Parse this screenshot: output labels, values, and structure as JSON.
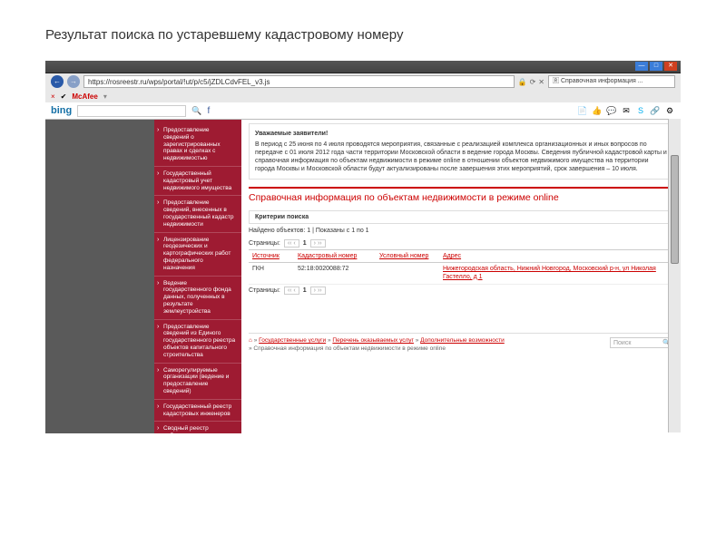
{
  "caption": "Результат поиска по устаревшему кадастровому номеру",
  "browser": {
    "url": "https://rosreestr.ru/wps/portal/!ut/p/c5/jZDLCdvFEL_v3.js",
    "tab_title": "Справочная информация ...",
    "close_x": "×",
    "mcafee": "McAfee",
    "bing": "bing",
    "win_min": "—",
    "win_max": "□",
    "win_close": "✕"
  },
  "sidebar": {
    "items": [
      "Предоставление сведений о зарегистрированных правах и сделках с недвижимостью",
      "Государственный кадастровый учет недвижимого имущества",
      "Предоставление сведений, внесенных в государственный кадастр недвижимости",
      "Лицензирование геодезических и картографических работ федерального назначения",
      "Ведение государственного фонда данных, полученных в результате землеустройства",
      "Предоставление сведений из Единого государственного реестра объектов капитального строительства",
      "Саморегулируемые организации (ведение и предоставление сведений)",
      "Государственный реестр кадастровых инженеров",
      "Сводный реестр арбитражных управляющих"
    ]
  },
  "notice": {
    "heading": "Уважаемые заявители!",
    "body": "В период с 25 июня по 4 июля проводятся мероприятия, связанные с реализацией комплекса организационных и иных вопросов по передаче с 01 июля 2012 года части территории Московской области в ведение города Москвы. Сведения публичной кадастровой карты и справочная информация по объектам недвижимости в режиме online в отношении объектов недвижимого имущества на территории города Москвы и Московской области будут актуализированы после завершения этих мероприятий, срок завершения – 10 июля."
  },
  "page_title": "Справочная информация по объектам недвижимости в режиме online",
  "criteria_label": "Критерии поиска",
  "found": "Найдено объектов: 1 | Показаны с 1 по 1",
  "pager_label": "Страницы:",
  "pager_prev": "‹‹ ‹",
  "pager_cur": "1",
  "pager_next": "› ››",
  "table": {
    "h_src": "Источник",
    "h_kad": "Кадастровый номер",
    "h_usl": "Условный номер",
    "h_addr": "Адрес",
    "rows": [
      {
        "src": "ГКН",
        "kad": "52:18:0020088:72",
        "usl": "",
        "addr": "Нижегородская область, Нижний Новгород, Московский р-н, ул Николая Гастелло, д 1"
      }
    ]
  },
  "crumbs": {
    "c1": "Государственные услуги",
    "c2": "Перечень оказываемых услуг",
    "c3": "Дополнительные возможности",
    "cur": "Справочная информация по объектам недвижимости в режиме online",
    "sep": " » "
  },
  "search_placeholder": "Поиск"
}
